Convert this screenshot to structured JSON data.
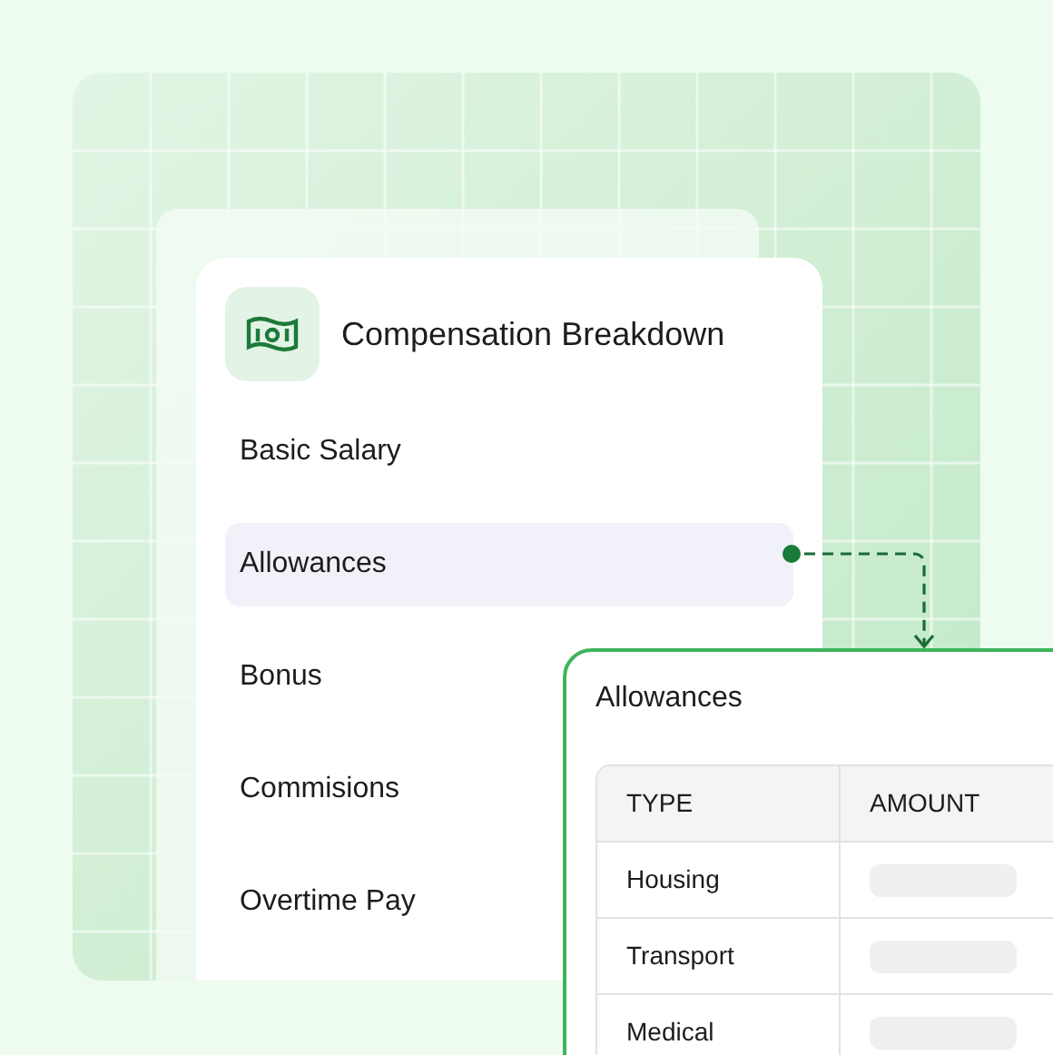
{
  "breakdown": {
    "title": "Compensation Breakdown",
    "items": [
      {
        "label": "Basic Salary",
        "selected": false
      },
      {
        "label": "Allowances",
        "selected": true
      },
      {
        "label": "Bonus",
        "selected": false
      },
      {
        "label": "Commisions",
        "selected": false
      },
      {
        "label": "Overtime Pay",
        "selected": false
      }
    ]
  },
  "detail": {
    "title": "Allowances",
    "columns": [
      "TYPE",
      "AMOUNT"
    ],
    "rows": [
      {
        "type": "Housing"
      },
      {
        "type": "Transport"
      },
      {
        "type": "Medical"
      }
    ]
  }
}
